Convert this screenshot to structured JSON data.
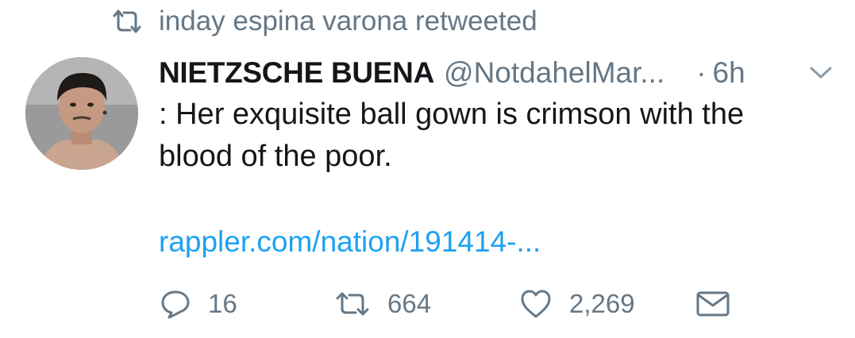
{
  "retweet_context": {
    "icon": "retweet-icon",
    "text": "inday espina varona retweeted"
  },
  "tweet": {
    "avatar": "avatar",
    "display_name": "NIETZSCHE BUENA",
    "handle": "@NotdahelMar...",
    "dot": "·",
    "time": "6h",
    "text": ": Her exquisite ball gown is crimson with the blood of the poor.",
    "link": "rappler.com/nation/191414-..."
  },
  "actions": {
    "reply": {
      "icon": "reply-icon",
      "count": "16"
    },
    "retweet": {
      "icon": "retweet-icon",
      "count": "664"
    },
    "like": {
      "icon": "heart-icon",
      "count": "2,269"
    },
    "dm": {
      "icon": "mail-icon"
    }
  },
  "colors": {
    "text": "#14171a",
    "secondary": "#657786",
    "link": "#1da1f2"
  }
}
